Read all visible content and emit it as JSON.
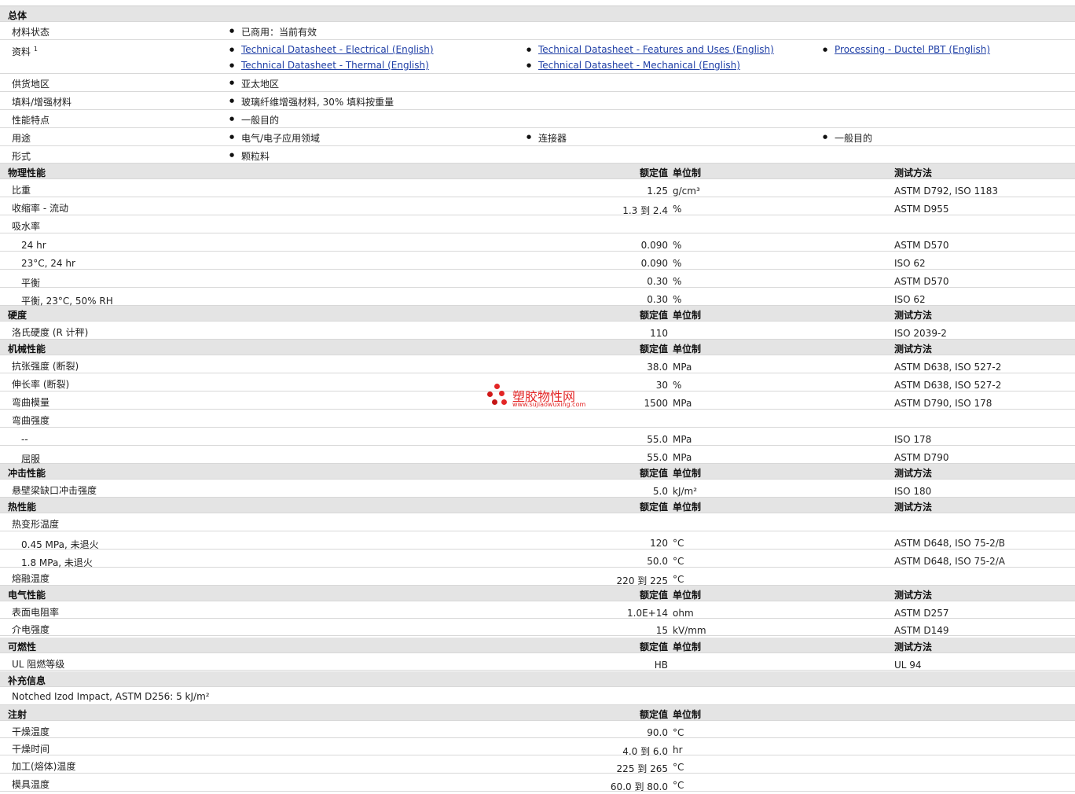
{
  "general": {
    "section": "总体",
    "status_label": "材料状态",
    "status_value": "已商用：当前有效",
    "docs_label": "资料",
    "docs_sup": "1",
    "docs": [
      "Technical Datasheet - Electrical (English)",
      "Technical Datasheet - Features and Uses (English)",
      "Processing - Ductel PBT (English)",
      "Technical Datasheet - Thermal (English)",
      "Technical Datasheet - Mechanical (English)"
    ],
    "region_label": "供货地区",
    "region_value": "亚太地区",
    "filler_label": "填料/增强材料",
    "filler_value": "玻璃纤维增强材料, 30% 填料按重量",
    "features_label": "性能特点",
    "features_value": "一般目的",
    "uses_label": "用途",
    "uses_values": [
      "电气/电子应用领域",
      "连接器",
      "一般目的"
    ],
    "form_label": "形式",
    "form_value": "颗粒料"
  },
  "col_headers": {
    "value": "额定值",
    "unit": "单位制",
    "method": "测试方法"
  },
  "physical": {
    "section": "物理性能",
    "rows": [
      {
        "label": "比重",
        "value": "1.25",
        "unit": "g/cm³",
        "method": "ASTM D792, ISO 1183"
      },
      {
        "label": "收缩率 - 流动",
        "value": "1.3 到  2.4",
        "unit": "%",
        "method": "ASTM D955"
      },
      {
        "label": "吸水率",
        "value": "",
        "unit": "",
        "method": ""
      },
      {
        "label": "24 hr",
        "value": "0.090",
        "unit": "%",
        "method": "ASTM D570"
      },
      {
        "label": "23°C, 24 hr",
        "value": "0.090",
        "unit": "%",
        "method": "ISO 62"
      },
      {
        "label": "平衡",
        "value": "0.30",
        "unit": "%",
        "method": "ASTM D570"
      },
      {
        "label": "平衡, 23°C, 50% RH",
        "value": "0.30",
        "unit": "%",
        "method": "ISO 62"
      }
    ]
  },
  "hardness": {
    "section": "硬度",
    "rows": [
      {
        "label": "洛氏硬度 (R 计秤)",
        "value": "110",
        "unit": "",
        "method": "ISO 2039-2"
      }
    ]
  },
  "mechanical": {
    "section": "机械性能",
    "rows": [
      {
        "label": "抗张强度 (断裂)",
        "value": "38.0",
        "unit": "MPa",
        "method": "ASTM D638, ISO 527-2"
      },
      {
        "label": "伸长率 (断裂)",
        "value": "30",
        "unit": "%",
        "method": "ASTM D638, ISO 527-2"
      },
      {
        "label": "弯曲模量",
        "value": "1500",
        "unit": "MPa",
        "method": "ASTM D790, ISO 178"
      },
      {
        "label": "弯曲强度",
        "value": "",
        "unit": "",
        "method": ""
      },
      {
        "label": "--",
        "value": "55.0",
        "unit": "MPa",
        "method": "ISO 178"
      },
      {
        "label": "屈服",
        "value": "55.0",
        "unit": "MPa",
        "method": "ASTM D790"
      }
    ]
  },
  "impact": {
    "section": "冲击性能",
    "rows": [
      {
        "label": "悬壁梁缺口冲击强度",
        "value": "5.0",
        "unit": "kJ/m²",
        "method": "ISO 180"
      }
    ]
  },
  "thermal": {
    "section": "热性能",
    "rows": [
      {
        "label": "热变形温度",
        "value": "",
        "unit": "",
        "method": ""
      },
      {
        "label": "0.45 MPa, 未退火",
        "value": "120",
        "unit": "°C",
        "method": "ASTM D648, ISO 75-2/B"
      },
      {
        "label": "1.8 MPa, 未退火",
        "value": "50.0",
        "unit": "°C",
        "method": "ASTM D648, ISO 75-2/A"
      },
      {
        "label": "熔融温度",
        "value": "220 到  225",
        "unit": "°C",
        "method": ""
      }
    ]
  },
  "electrical": {
    "section": "电气性能",
    "rows": [
      {
        "label": "表面电阻率",
        "value": "1.0E+14",
        "unit": "ohm",
        "method": "ASTM D257"
      },
      {
        "label": "介电强度",
        "value": "15",
        "unit": "kV/mm",
        "method": "ASTM D149"
      }
    ]
  },
  "flammability": {
    "section": "可燃性",
    "rows": [
      {
        "label": "UL 阻燃等级",
        "value": "HB",
        "unit": "",
        "method": "UL 94"
      }
    ]
  },
  "supplement": {
    "section": "补充信息",
    "text": "Notched Izod Impact, ASTM D256: 5 kJ/m²"
  },
  "injection": {
    "section": "注射",
    "rows": [
      {
        "label": "干燥温度",
        "value": "90.0",
        "unit": "°C"
      },
      {
        "label": "干燥时间",
        "value": "4.0 到  6.0",
        "unit": "hr"
      },
      {
        "label": "加工(熔体)温度",
        "value": "225 到  265",
        "unit": "°C"
      },
      {
        "label": "模具温度",
        "value": "60.0 到  80.0",
        "unit": "°C"
      }
    ]
  },
  "watermark": {
    "title": "塑胶物性网",
    "url": "www.sujiaowuxing.com"
  }
}
